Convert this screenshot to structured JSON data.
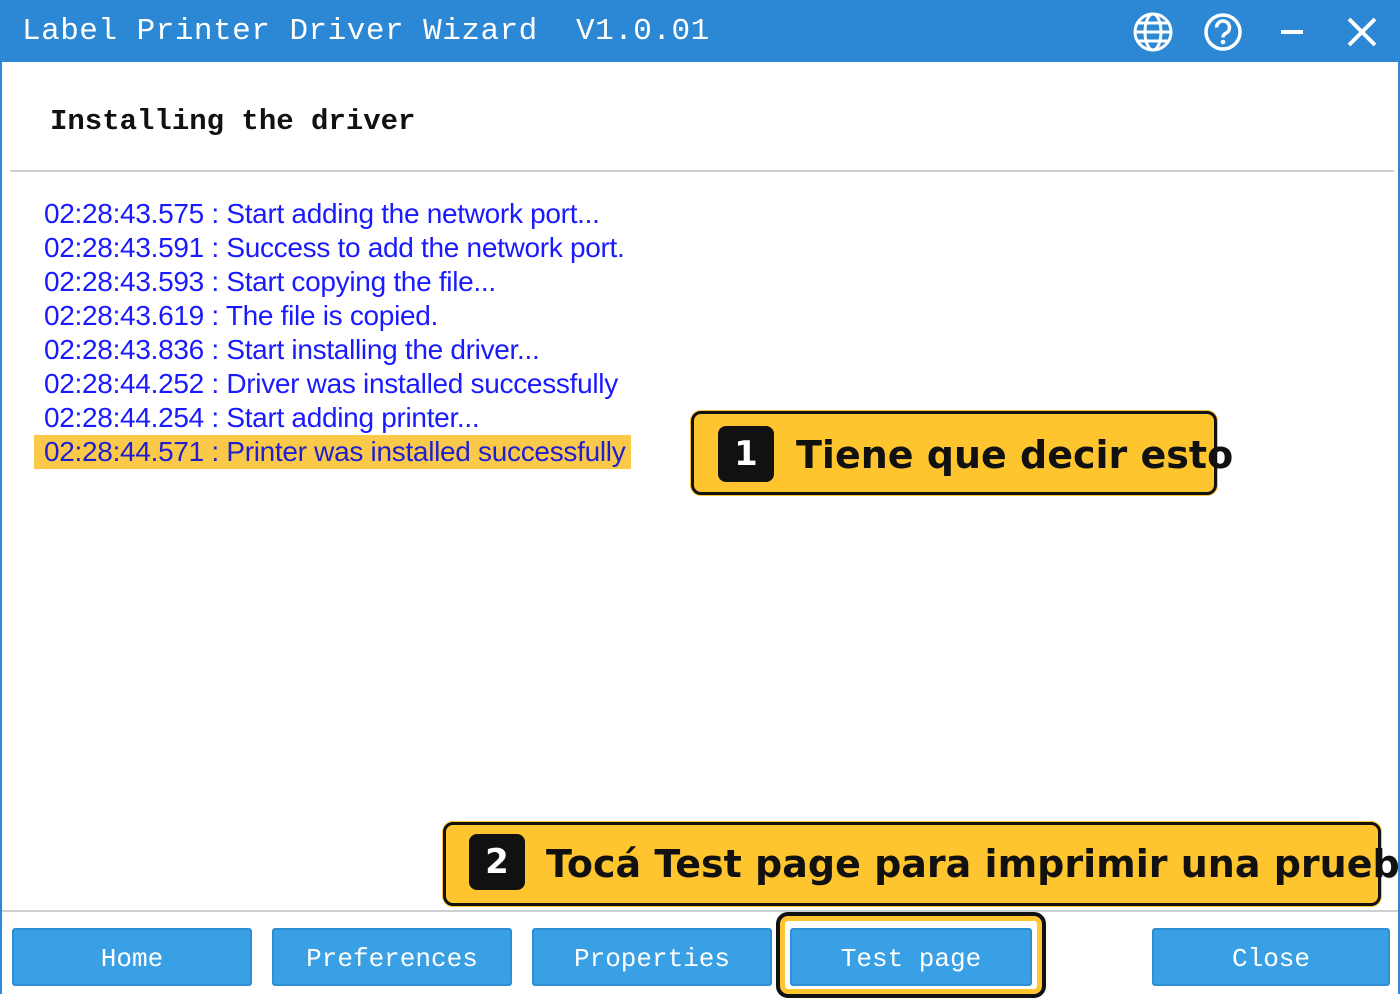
{
  "window": {
    "title": "Label Printer Driver Wizard  V1.0.01",
    "icons": [
      "globe-icon",
      "help-icon",
      "minimize-icon",
      "close-icon"
    ]
  },
  "page": {
    "heading": "Installing the driver"
  },
  "log": [
    {
      "text": "02:28:43.575 : Start adding the network port...",
      "highlighted": false
    },
    {
      "text": "02:28:43.591 : Success to add the network port.",
      "highlighted": false
    },
    {
      "text": "02:28:43.593 : Start copying the file...",
      "highlighted": false
    },
    {
      "text": "02:28:43.619 : The file is copied.",
      "highlighted": false
    },
    {
      "text": "02:28:43.836 : Start installing the driver...",
      "highlighted": false
    },
    {
      "text": "02:28:44.252 : Driver was installed successfully",
      "highlighted": false
    },
    {
      "text": "02:28:44.254 : Start adding printer...",
      "highlighted": false
    },
    {
      "text": "02:28:44.571 : Printer was installed successfully",
      "highlighted": true
    }
  ],
  "callouts": [
    {
      "number": "1",
      "text": "Tiene que decir esto"
    },
    {
      "number": "2",
      "text": "Tocá Test page para imprimir una prueba"
    }
  ],
  "buttons": {
    "home": "Home",
    "preferences": "Preferences",
    "properties": "Properties",
    "test_page": "Test page",
    "close": "Close"
  },
  "colors": {
    "titlebar": "#2c87d4",
    "button": "#3aa0e6",
    "log_text": "#1a1aff",
    "highlight": "#fbc94a",
    "callout": "#fec52e"
  }
}
